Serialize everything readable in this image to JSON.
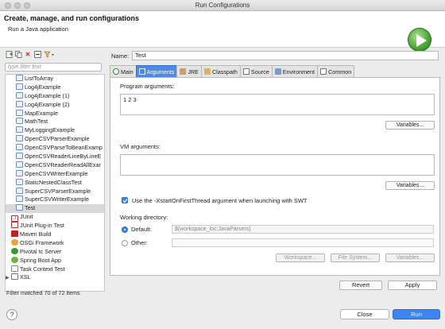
{
  "window": {
    "title": "Run Configurations"
  },
  "banner": {
    "title": "Create, manage, and run configurations",
    "subtitle": "Run a Java application"
  },
  "toolbar": {
    "icons": [
      "new-config-icon",
      "duplicate-icon",
      "delete-icon",
      "collapse-all-icon",
      "filter-icon"
    ]
  },
  "filter": {
    "placeholder": "type filter text"
  },
  "tree": {
    "children": [
      "ListToArray",
      "Log4jExample",
      "Log4jExample (1)",
      "Log4jExample (2)",
      "MapExample",
      "MathTest",
      "MyLoggingExample",
      "OpenCSVParserExample",
      "OpenCSVParseToBeanExamp",
      "OpenCSVReaderLineByLineE",
      "OpenCSVReaderReadAllExar",
      "OpenCSVWriterExample",
      "StaticNestedClassTest",
      "SuperCSVParserExample",
      "SuperCSVWriterExample",
      "Test"
    ],
    "selected": "Test",
    "categories": [
      "JUnit",
      "JUnit Plug-in Test",
      "Maven Build",
      "OSGi Framework",
      "Pivotal tc Server",
      "Spring Boot App",
      "Task Context Test",
      "XSL"
    ]
  },
  "status": "Filter matched 70 of 72 items",
  "name": {
    "label": "Name:",
    "value": "Test"
  },
  "tabs": [
    "Main",
    "Arguments",
    "JRE",
    "Classpath",
    "Source",
    "Environment",
    "Common"
  ],
  "active_tab": "Arguments",
  "program_args": {
    "label": "Program arguments:",
    "value": "1 2 3",
    "variables": "Variables..."
  },
  "vm_args": {
    "label": "VM arguments:",
    "value": "",
    "variables": "Variables..."
  },
  "xstart": {
    "label": "Use the -XstartOnFirstThread argument when launching with SWT",
    "checked": true
  },
  "working_dir": {
    "label": "Working directory:",
    "default_label": "Default:",
    "default_value": "${workspace_loc:JavaParsers}",
    "other_label": "Other:",
    "workspace_btn": "Workspace...",
    "filesystem_btn": "File System...",
    "variables_btn": "Variables..."
  },
  "buttons": {
    "revert": "Revert",
    "apply": "Apply",
    "close": "Close",
    "run": "Run",
    "help": "?"
  },
  "colors": {
    "accent": "#3d86f2",
    "run_green": "#3c9a2a"
  }
}
